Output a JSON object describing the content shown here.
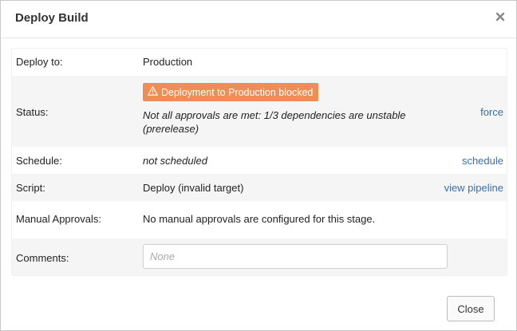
{
  "dialog": {
    "title": "Deploy Build",
    "close_icon": "close-icon"
  },
  "rows": {
    "deploy_to": {
      "label": "Deploy to:",
      "value": "Production"
    },
    "status": {
      "label": "Status:",
      "badge_icon": "warning-icon",
      "badge_text": "Deployment to Production blocked",
      "message": "Not all approvals are met: 1/3 dependencies are unstable (prerelease)",
      "action": "force"
    },
    "schedule": {
      "label": "Schedule:",
      "value": "not scheduled",
      "action": "schedule"
    },
    "script": {
      "label": "Script:",
      "value": "Deploy (invalid target)",
      "action": "view pipeline"
    },
    "manual_approvals": {
      "label": "Manual Approvals:",
      "value": "No manual approvals are configured for this stage."
    },
    "comments": {
      "label": "Comments:",
      "placeholder": "None",
      "value": ""
    }
  },
  "footer": {
    "close_label": "Close"
  },
  "colors": {
    "badge_bg": "#ef8d55",
    "link": "#3a6fa4",
    "alt_row": "#f5f5f5"
  }
}
